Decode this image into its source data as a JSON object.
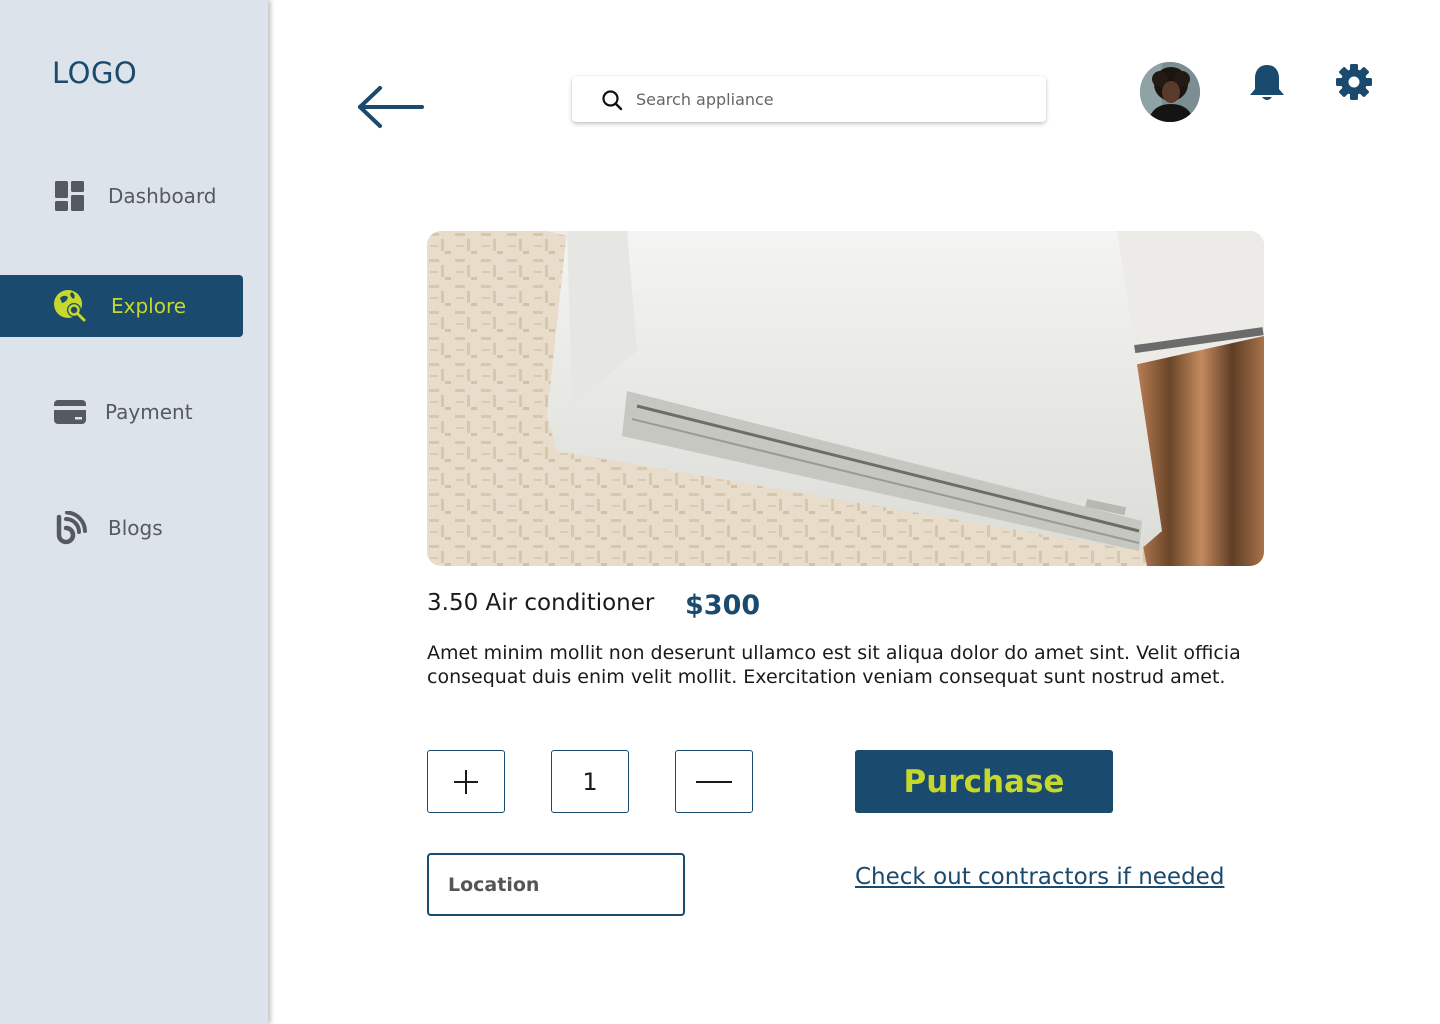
{
  "colors": {
    "brand": "#1a4a6e",
    "accent": "#c6d82b",
    "sidebar_bg": "#dde3ea",
    "nav_text": "#555a60"
  },
  "sidebar": {
    "logo": "LOGO",
    "items": [
      {
        "label": "Dashboard",
        "icon": "dashboard-icon",
        "active": false
      },
      {
        "label": "Explore",
        "icon": "explore-icon",
        "active": true
      },
      {
        "label": "Payment",
        "icon": "credit-card-icon",
        "active": false
      },
      {
        "label": "Blogs",
        "icon": "blog-icon",
        "active": false
      }
    ]
  },
  "header": {
    "back_icon": "arrow-left-icon",
    "search": {
      "placeholder": "Search appliance",
      "value": "",
      "icon": "search-icon"
    },
    "avatar_icon": "user-avatar",
    "notifications_icon": "bell-icon",
    "settings_icon": "gear-icon"
  },
  "product": {
    "image_icon": "air-conditioner-image",
    "name": "3.50 Air conditioner",
    "price": "$300",
    "description": "Amet minim mollit non deserunt ullamco est sit aliqua dolor do amet sint. Velit officia consequat duis enim velit mollit. Exercitation veniam consequat sunt nostrud amet.",
    "quantity": "1",
    "increment_icon": "plus-icon",
    "decrement_icon": "minus-icon",
    "purchase_label": "Purchase",
    "location_placeholder": "Location",
    "contractors_link": "Check out contractors if needed"
  }
}
